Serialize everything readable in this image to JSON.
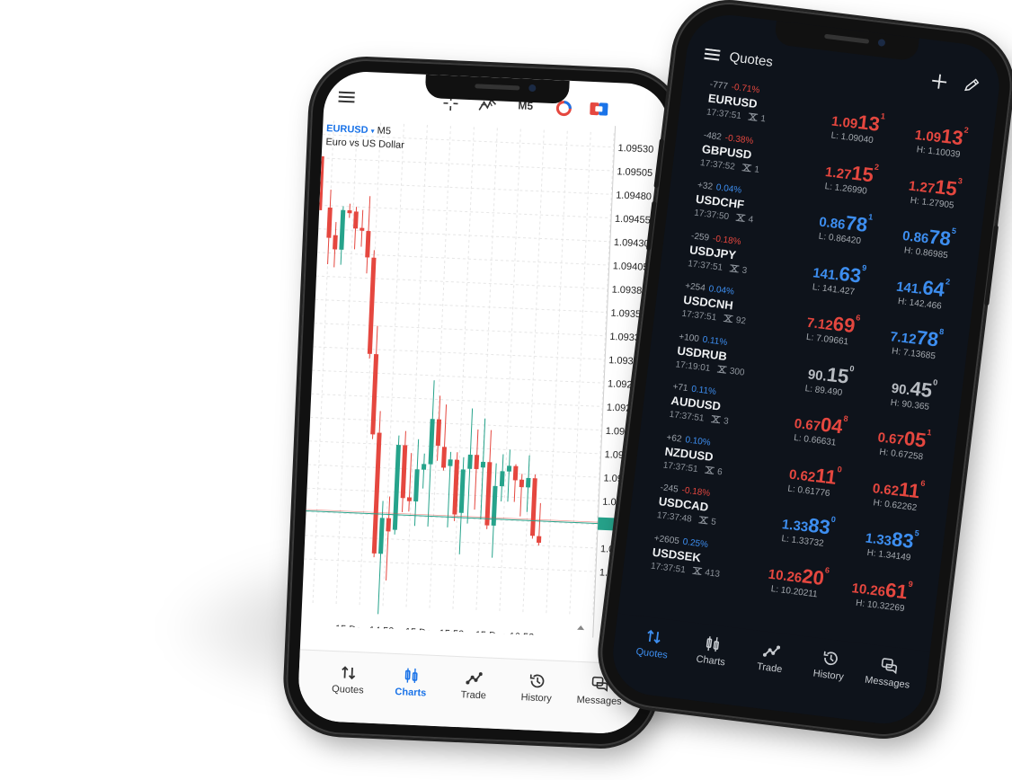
{
  "colors": {
    "up": "#26a38b",
    "down": "#e5473f",
    "accent": "#1a73e8",
    "dark_bg": "#0e131b",
    "price_red": "#e5473f",
    "price_blue": "#3d8ef0",
    "price_gray": "#b8bcc2"
  },
  "chart_phone": {
    "toolbar": {
      "menu_icon": "hamburger-icon",
      "crosshair_icon": "crosshair-icon",
      "indicators_icon": "indicators-icon",
      "timeframe": "M5",
      "objects_icon": "pie-clock-icon",
      "trade_icon": "one-click-trade-icon"
    },
    "symbol": "EURUSD",
    "symbol_caret": "▾",
    "timeframe": "M5",
    "description": "Euro vs US Dollar",
    "nav": [
      {
        "label": "Quotes",
        "icon": "arrows-up-down-icon"
      },
      {
        "label": "Charts",
        "icon": "candles-icon",
        "active": true
      },
      {
        "label": "Trade",
        "icon": "trend-icon"
      },
      {
        "label": "History",
        "icon": "history-icon"
      },
      {
        "label": "Messages",
        "icon": "messages-icon"
      }
    ]
  },
  "chart_data": {
    "type": "candlestick",
    "symbol": "EURUSD",
    "timeframe": "M5",
    "ylim": [
      1.09031,
      1.09545
    ],
    "y_ticks": [
      "1.09530",
      "1.09505",
      "1.09480",
      "1.09455",
      "1.09430",
      "1.09405",
      "1.09380",
      "1.09355",
      "1.09330",
      "1.09305",
      "1.09280",
      "1.09255",
      "1.09230",
      "1.09205",
      "1.09180",
      "1.09155",
      "1.09130",
      "1.09105",
      "1.09080"
    ],
    "x_ticks": [
      "15 Dec 14:50",
      "15 Dec 15:50",
      "15 Dec 16:50"
    ],
    "grid": true,
    "current_price": 1.09131,
    "candles": [
      [
        1.09453,
        1.09472,
        1.09393,
        1.09421
      ],
      [
        1.09424,
        1.09438,
        1.0939,
        1.09409
      ],
      [
        1.09409,
        1.09455,
        1.09393,
        1.09451
      ],
      [
        1.09451,
        1.09458,
        1.09443,
        1.09448
      ],
      [
        1.0945,
        1.09455,
        1.0941,
        1.09432
      ],
      [
        1.09433,
        1.09452,
        1.09413,
        1.0943
      ],
      [
        1.0943,
        1.09467,
        1.09385,
        1.09402
      ],
      [
        1.09402,
        1.0941,
        1.09295,
        1.093
      ],
      [
        1.093,
        1.0933,
        1.0921,
        1.09215
      ],
      [
        1.09217,
        1.0924,
        1.09085,
        1.09089
      ],
      [
        1.09089,
        1.09145,
        1.09025,
        1.09127
      ],
      [
        1.09127,
        1.0915,
        1.09061,
        1.09113
      ],
      [
        1.09115,
        1.09215,
        1.0911,
        1.09205
      ],
      [
        1.09205,
        1.0922,
        1.09134,
        1.09149
      ],
      [
        1.0915,
        1.09197,
        1.09135,
        1.09146
      ],
      [
        1.09146,
        1.09212,
        1.0912,
        1.0918
      ],
      [
        1.0918,
        1.09197,
        1.0916,
        1.09186
      ],
      [
        1.09186,
        1.09275,
        1.0912,
        1.09234
      ],
      [
        1.09234,
        1.09259,
        1.0919,
        1.09206
      ],
      [
        1.09205,
        1.0925,
        1.0918,
        1.09183
      ],
      [
        1.09185,
        1.092,
        1.0912,
        1.09192
      ],
      [
        1.09192,
        1.092,
        1.09127,
        1.09134
      ],
      [
        1.09136,
        1.09195,
        1.09092,
        1.09182
      ],
      [
        1.09183,
        1.09247,
        1.09125,
        1.09198
      ],
      [
        1.09198,
        1.09225,
        1.0914,
        1.09183
      ],
      [
        1.09185,
        1.09237,
        1.0913,
        1.09191
      ],
      [
        1.09191,
        1.09225,
        1.0912,
        1.09124
      ],
      [
        1.09124,
        1.0919,
        1.0909,
        1.09166
      ],
      [
        1.09166,
        1.092,
        1.0915,
        1.09182
      ],
      [
        1.09182,
        1.09205,
        1.0915,
        1.09188
      ],
      [
        1.09188,
        1.0919,
        1.0915,
        1.09173
      ],
      [
        1.09174,
        1.0918,
        1.09135,
        1.09166
      ],
      [
        1.09166,
        1.092,
        1.0914,
        1.09176
      ],
      [
        1.09176,
        1.0918,
        1.09112,
        1.09115
      ],
      [
        1.09115,
        1.0915,
        1.09105,
        1.09108
      ]
    ]
  },
  "quotes_phone": {
    "header": {
      "menu_icon": "hamburger-icon",
      "title": "Quotes",
      "add_icon": "plus-icon",
      "edit_icon": "pencil-icon"
    },
    "rows": [
      {
        "symbol": "EURUSD",
        "points": "-777",
        "pct": "-0.71%",
        "dir": "down",
        "time": "17:37:51",
        "spread": "1",
        "color": "red",
        "bid": {
          "pre": "1.09",
          "big": "13",
          "sup": "1"
        },
        "ask": {
          "pre": "1.09",
          "big": "13",
          "sup": "2"
        },
        "low": "L: 1.09040",
        "high": "H: 1.10039"
      },
      {
        "symbol": "GBPUSD",
        "points": "-482",
        "pct": "-0.38%",
        "dir": "down",
        "time": "17:37:52",
        "spread": "1",
        "color": "red",
        "bid": {
          "pre": "1.27",
          "big": "15",
          "sup": "2"
        },
        "ask": {
          "pre": "1.27",
          "big": "15",
          "sup": "3"
        },
        "low": "L: 1.26990",
        "high": "H: 1.27905"
      },
      {
        "symbol": "USDCHF",
        "points": "+32",
        "pct": "0.04%",
        "dir": "up",
        "time": "17:37:50",
        "spread": "4",
        "color": "blue",
        "bid": {
          "pre": "0.86",
          "big": "78",
          "sup": "1"
        },
        "ask": {
          "pre": "0.86",
          "big": "78",
          "sup": "5"
        },
        "low": "L: 0.86420",
        "high": "H: 0.86985"
      },
      {
        "symbol": "USDJPY",
        "points": "-259",
        "pct": "-0.18%",
        "dir": "down",
        "time": "17:37:51",
        "spread": "3",
        "color": "blue",
        "bid": {
          "pre": "141.",
          "big": "63",
          "sup": "9"
        },
        "ask": {
          "pre": "141.",
          "big": "64",
          "sup": "2"
        },
        "low": "L: 141.427",
        "high": "H: 142.466"
      },
      {
        "symbol": "USDCNH",
        "points": "+254",
        "pct": "0.04%",
        "dir": "up",
        "time": "17:37:51",
        "spread": "92",
        "color": "red",
        "ask_color": "blue",
        "bid": {
          "pre": "7.12",
          "big": "69",
          "sup": "6"
        },
        "ask": {
          "pre": "7.12",
          "big": "78",
          "sup": "8"
        },
        "low": "L: 7.09661",
        "high": "H: 7.13685"
      },
      {
        "symbol": "USDRUB",
        "points": "+100",
        "pct": "0.11%",
        "dir": "up",
        "time": "17:19:01",
        "spread": "300",
        "color": "gray",
        "bid": {
          "pre": "90.",
          "big": "15",
          "sup": "0"
        },
        "ask": {
          "pre": "90.",
          "big": "45",
          "sup": "0"
        },
        "low": "L: 89.490",
        "high": "H: 90.365"
      },
      {
        "symbol": "AUDUSD",
        "points": "+71",
        "pct": "0.11%",
        "dir": "up",
        "time": "17:37:51",
        "spread": "3",
        "color": "red",
        "bid": {
          "pre": "0.67",
          "big": "04",
          "sup": "8"
        },
        "ask": {
          "pre": "0.67",
          "big": "05",
          "sup": "1"
        },
        "low": "L: 0.66631",
        "high": "H: 0.67258"
      },
      {
        "symbol": "NZDUSD",
        "points": "+62",
        "pct": "0.10%",
        "dir": "up",
        "time": "17:37:51",
        "spread": "6",
        "color": "red",
        "bid": {
          "pre": "0.62",
          "big": "11",
          "sup": "0"
        },
        "ask": {
          "pre": "0.62",
          "big": "11",
          "sup": "6"
        },
        "low": "L: 0.61776",
        "high": "H: 0.62262"
      },
      {
        "symbol": "USDCAD",
        "points": "-245",
        "pct": "-0.18%",
        "dir": "down",
        "time": "17:37:48",
        "spread": "5",
        "color": "blue",
        "bid": {
          "pre": "1.33",
          "big": "83",
          "sup": "0"
        },
        "ask": {
          "pre": "1.33",
          "big": "83",
          "sup": "5"
        },
        "low": "L: 1.33732",
        "high": "H: 1.34149"
      },
      {
        "symbol": "USDSEK",
        "points": "+2605",
        "pct": "0.25%",
        "dir": "up",
        "time": "17:37:51",
        "spread": "413",
        "color": "red",
        "bid": {
          "pre": "10.26",
          "big": "20",
          "sup": "6"
        },
        "ask": {
          "pre": "10.26",
          "big": "61",
          "sup": "9"
        },
        "low": "L: 10.20211",
        "high": "H: 10.32269"
      }
    ],
    "nav": [
      {
        "label": "Quotes",
        "icon": "arrows-up-down-icon",
        "active": true
      },
      {
        "label": "Charts",
        "icon": "candles-icon"
      },
      {
        "label": "Trade",
        "icon": "trend-icon"
      },
      {
        "label": "History",
        "icon": "history-icon"
      },
      {
        "label": "Messages",
        "icon": "messages-icon"
      }
    ]
  }
}
